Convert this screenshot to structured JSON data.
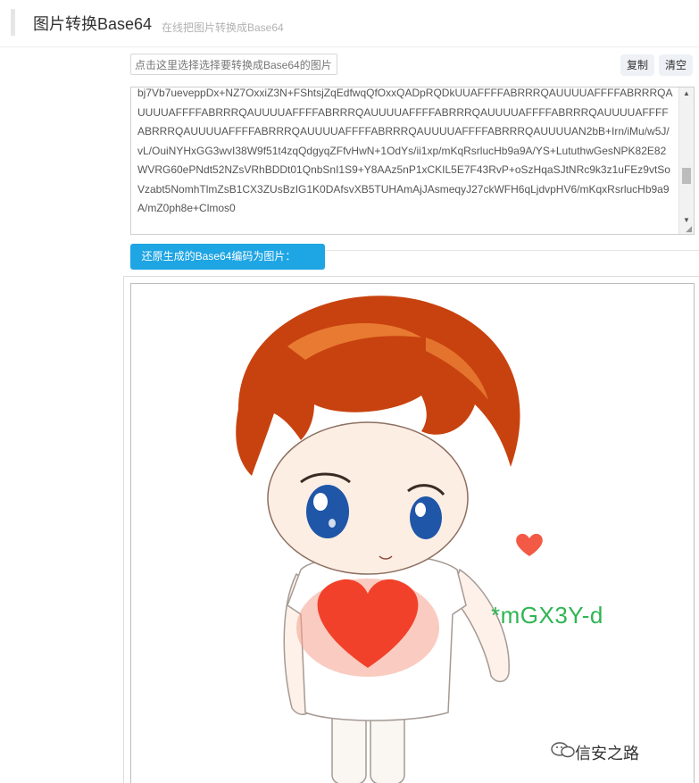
{
  "header": {
    "title": "图片转换Base64",
    "subtitle": "在线把图片转换成Base64"
  },
  "toolbar": {
    "file_input_text": "点击这里选择选择要转换成Base64的图片",
    "copy_label": "复制",
    "clear_label": "清空"
  },
  "base64": {
    "text": "bj7Vb7ueveppDx+NZ7OxxiZ3N+FShtsjZqEdfwqQfOxxQADpRQDkUUAFFFFABRRRQAUUUUAFFFFABRRRQAUUUUAFFFFABRRRQAUUUUAFFFFABRRRQAUUUUAFFFFABRRRQAUUUUAFFFFABRRRQAUUUUAFFFFABRRRQAUUUUAFFFFABRRRQAUUUUAFFFFABRRRQAUUUUAFFFFABRRRQAUUUUAN2bB+Irn/iMu/w5J/vL/OuiNYHxGG3wvI38W9f51t4zqQdgyqZFfvHwN+1OdYs/ii1xp/mKqRsrlucHb9a9A/YS+LututhwGesNPK82E82WVRG60ePNdt52NZsVRhBDDt01QnbSnI1S9+Y8AAz5nP1xCKIL5E7F43RvP+oSzHqaSJtNRc9k3z1uFEz9vtSoVzabt5NomhTlmZsB1CX3ZUsBzIG1K0DAfsvXB5TUHAmAjJAsmeqyJ27ckWFH6qLjdvpHV6/mKqxRsrlucHb9a9A/mZ0ph8e+Clmos0",
    "scroll_up": "▲",
    "scroll_down": "▼",
    "resize": "◢"
  },
  "restore_button_label": "还原生成的Base64编码为图片：",
  "preview": {
    "overlay_text": "*mGX3Y-d",
    "watermark": "信安之路",
    "watermark_icon": "wechat-icon",
    "colors": {
      "hair": "#c8420f",
      "heart": "#f2412a",
      "eyes": "#1f56a8",
      "text_green": "#2fb554"
    }
  },
  "colors": {
    "accent": "#1ea5e4",
    "header_bar": "#e6e6e6"
  }
}
